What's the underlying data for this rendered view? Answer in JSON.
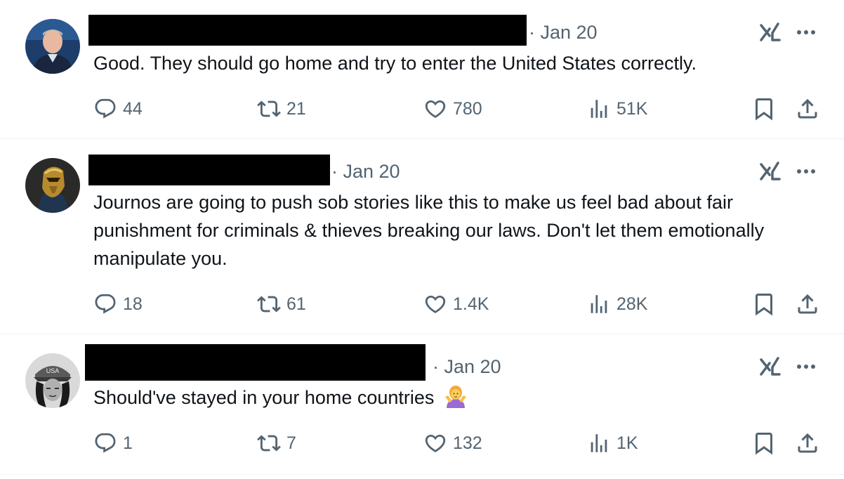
{
  "tweets": [
    {
      "date": "· Jan 20",
      "text": "Good. They should go home and try to enter the United States correctly.",
      "replies": "44",
      "reposts": "21",
      "likes": "780",
      "views": "51K"
    },
    {
      "date": "· Jan 20",
      "text": "Journos are going to push sob stories like this to make us feel bad about fair punishment for criminals & thieves breaking our laws.  Don't let them emotionally manipulate you.",
      "replies": "18",
      "reposts": "61",
      "likes": "1.4K",
      "views": "28K"
    },
    {
      "date": "· Jan 20",
      "text": "Should've stayed in your home countries",
      "emoji": "woman-shrugging-icon",
      "replies": "1",
      "reposts": "7",
      "likes": "132",
      "views": "1K"
    }
  ],
  "colors": {
    "text": "#0f1419",
    "muted": "#536471",
    "divider": "#eff3f4"
  },
  "icons": [
    "reply-icon",
    "repost-icon",
    "like-icon",
    "views-icon",
    "bookmark-icon",
    "share-icon",
    "grok-icon",
    "more-icon"
  ]
}
